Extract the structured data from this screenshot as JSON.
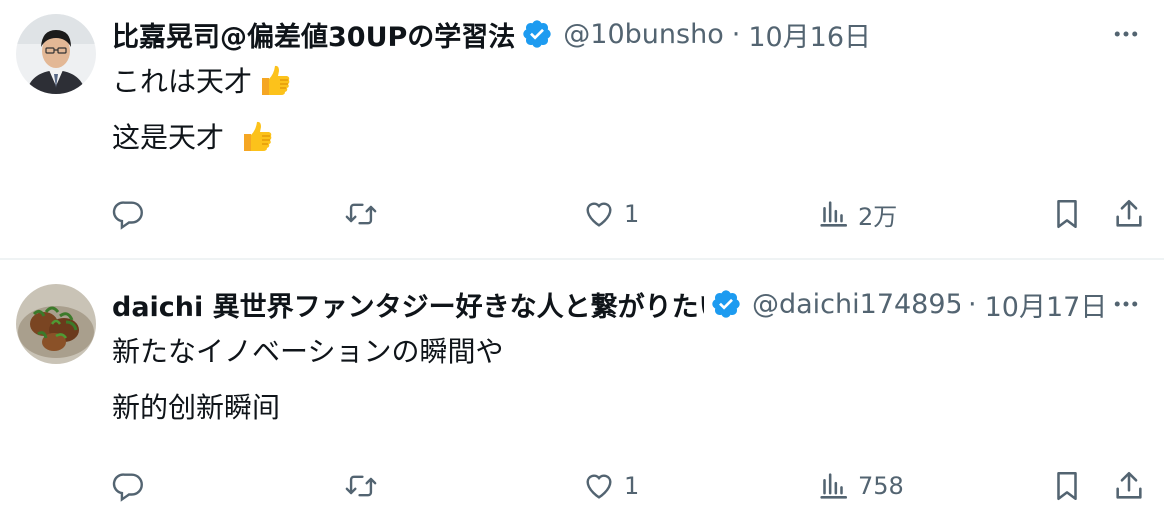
{
  "tweets": [
    {
      "display_name": "比嘉晃司@偏差値30UPの学習法",
      "handle": "@10bunsho",
      "dot": "·",
      "date": "10月16日",
      "lines": [
        "これは天才👍",
        "这是天才 👍"
      ],
      "line_texts": [
        "これは天才",
        "这是天才"
      ],
      "likes": "1",
      "views": "2万"
    },
    {
      "display_name": "daichi 異世界ファンタジー好きな人と繋がりたい",
      "handle": "@daichi174895",
      "dot": "·",
      "date": "10月17日",
      "lines": [
        "新たなイノベーションの瞬間や",
        "新的创新瞬间"
      ],
      "likes": "1",
      "views": "758"
    }
  ],
  "icons": [
    "verified-badge-icon",
    "more-icon",
    "reply-icon",
    "retweet-icon",
    "like-icon",
    "views-icon",
    "bookmark-icon",
    "share-icon",
    "thumbs-up-emoji"
  ],
  "colors": {
    "verified": "#1d9bf0",
    "secondary_text": "#536471",
    "primary_text": "#0f1419",
    "divider": "#eff3f4"
  }
}
